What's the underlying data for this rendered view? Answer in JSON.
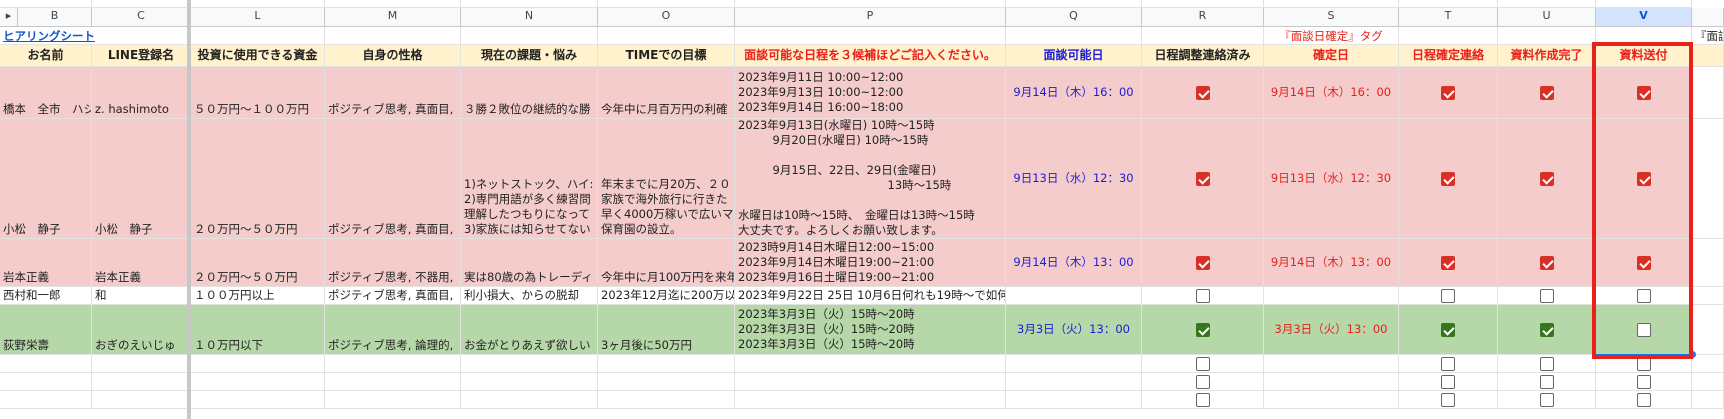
{
  "colors": {
    "pink": "#f4cccc",
    "green": "#b6d7a8",
    "header": "#fff2cc",
    "blue_text": "#1c1cd6",
    "red_text": "#e8211a",
    "check_red": "#d93025",
    "check_green": "#38761d",
    "annotation_box": "#e8211a"
  },
  "columns": [
    "B",
    "C",
    "L",
    "M",
    "N",
    "O",
    "P",
    "Q",
    "R",
    "S",
    "T",
    "U",
    "V"
  ],
  "selected_column": "V",
  "row2": {
    "sheet_link": "ヒアリングシート",
    "tag_note": "『面談日確定』タグ",
    "tag_note_cut": "『面談"
  },
  "headers": [
    "お名前",
    "LINE登録名",
    "投資に使用できる資金",
    "自身の性格",
    "現在の課題・悩み",
    "TIMEでの目標",
    "面談可能な日程を３候補ほどご記入ください。",
    "面談可能日",
    "日程調整連絡済み",
    "確定日",
    "日程確定連絡",
    "資料作成完了",
    "資料送付"
  ],
  "rows": [
    {
      "color": "pink",
      "name": "橋本　全市　ハシ",
      "line": "z. hashimoto",
      "funds": "５０万円〜１００万円",
      "personality": "ポジティブ思考, 真面目,",
      "issues": "３勝２敗位の継続的な勝",
      "goal": "今年中に月百万円の利確",
      "schedule": "2023年9月11日 10:00~12:00\n2023年9月13日 10:00~12:00\n2023年9月14日 16:00~18:00",
      "available": "9月14日（木）16：00",
      "contacted": true,
      "confirmed": "9月14日（木）16：00",
      "confirm_contact": true,
      "material_done": true,
      "material_sent": true
    },
    {
      "color": "pink",
      "name": "小松　静子",
      "line": "小松　静子",
      "funds": "２０万円〜５０万円",
      "personality": "ポジティブ思考, 真面目,",
      "issues": "1)ネットストック、ハイ:\n2)専門用語が多く練習問\n理解したつもりになって\n3)家族には知らせてない",
      "goal": "年末までに月20万、２０\n家族で海外旅行に行きた\n早く4000万稼いで広いマ\n保育園の設立。",
      "schedule": "2023年9月13日(水曜日) 10時〜15時\n　　　9月20日(水曜日) 10時〜15時\n\n　　　9月15日、22日、29日(金曜日)\n　　　　　　　　　　　　　13時〜15時\n\n水曜日は10時〜15時、　金曜日は13時〜15時\n大丈夫です。よろしくお願い致します。",
      "available": "9日13日（水）12：30",
      "contacted": true,
      "confirmed": "9日13日（水）12：30",
      "confirm_contact": true,
      "material_done": true,
      "material_sent": true
    },
    {
      "color": "pink",
      "name": "岩本正義",
      "line": "岩本正義",
      "funds": "２０万円〜５０万円",
      "personality": "ポジティブ思考, 不器用,",
      "issues": "実は80歳の為トレーディ",
      "goal": "今年中に月100万円を来年",
      "schedule": "2023時9月14日木曜日12:00~15:00\n2023年9月14日木曜日19:00~21:00\n2023年9月16日土曜日19:00~21:00",
      "available": "9月14日（木）13：00",
      "contacted": true,
      "confirmed": "9月14日（木）13：00",
      "confirm_contact": true,
      "material_done": true,
      "material_sent": true
    },
    {
      "color": "white",
      "name": "西村和一郎",
      "line": "和",
      "funds": "１００万円以上",
      "personality": "ポジティブ思考, 真面目,",
      "issues": "利小損大、からの脱却",
      "goal": "2023年12月迄に200万以",
      "schedule": "2023年9月22日 25日 10月6日何れも19時〜で如何でしょうか?",
      "available": "",
      "contacted": false,
      "confirmed": "",
      "confirm_contact": false,
      "material_done": false,
      "material_sent": false
    },
    {
      "color": "green",
      "name": "荻野栄壽",
      "line": "おぎのえいじゅ",
      "funds": "１０万円以下",
      "personality": "ポジティブ思考, 論理的,",
      "issues": "お金がとりあえず欲しい",
      "goal": "3ヶ月後に50万円",
      "schedule": "2023年3月3日（火）15時〜20時\n2023年3月3日（火）15時〜20時\n2023年3月3日（火）15時〜20時",
      "available": "3月3日（火）13：00",
      "contacted": true,
      "confirmed": "3月3日（火）13：00",
      "confirm_contact": true,
      "material_done": true,
      "material_sent": false
    }
  ]
}
